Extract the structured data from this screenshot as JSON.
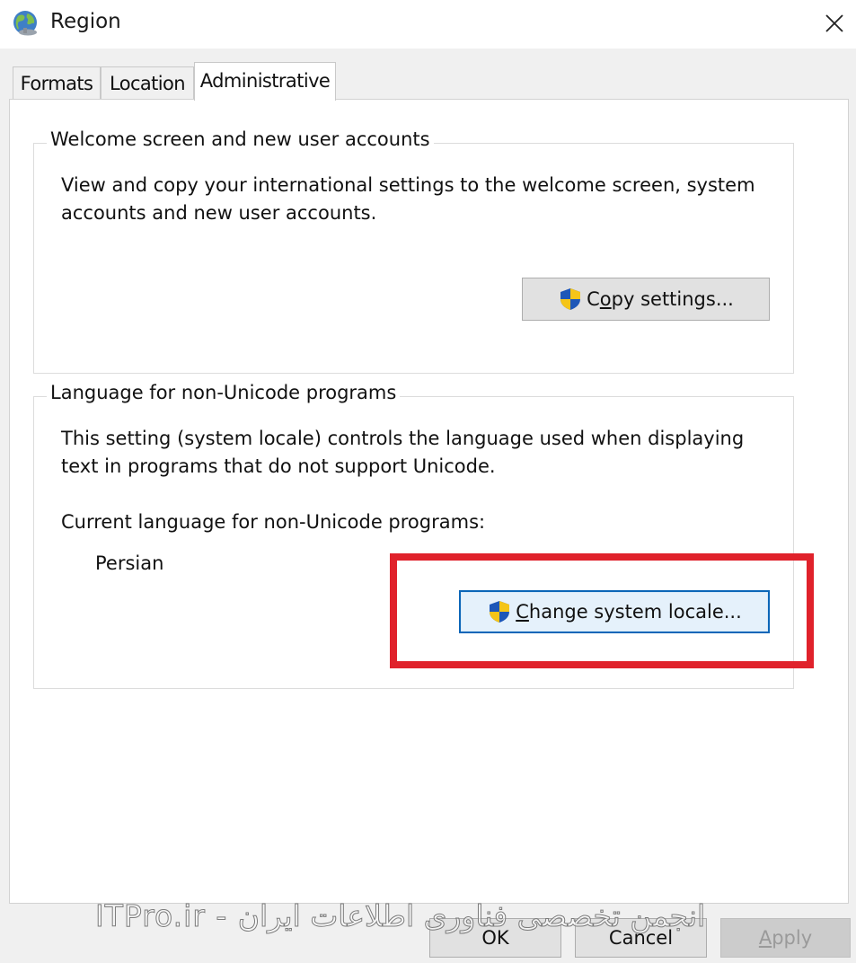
{
  "window": {
    "title": "Region",
    "close_icon": "close-icon"
  },
  "tabs": [
    {
      "label": "Formats",
      "active": false
    },
    {
      "label": "Location",
      "active": false
    },
    {
      "label": "Administrative",
      "active": true
    }
  ],
  "welcome_group": {
    "legend": "Welcome screen and new user accounts",
    "description_line1": "View and copy your international settings to the welcome screen, system",
    "description_line2": "accounts and new user accounts.",
    "copy_button": {
      "prefix": "C",
      "underlined": "o",
      "suffix": "py settings...",
      "icon": "uac-shield-icon"
    }
  },
  "locale_group": {
    "legend": "Language for non-Unicode programs",
    "description_line1": "This setting (system locale) controls the language used when displaying",
    "description_line2": "text in programs that do not support Unicode.",
    "current_label": "Current language for non-Unicode programs:",
    "current_value": "Persian",
    "change_button": {
      "underlined": "C",
      "suffix": "hange system locale...",
      "icon": "uac-shield-icon"
    }
  },
  "footer": {
    "ok_label": "OK",
    "cancel_label": "Cancel",
    "apply_prefix": "",
    "apply_underlined": "A",
    "apply_suffix": "pply"
  },
  "watermark": "ITPro.ir - انجمن تخصصی فناوری اطلاعات ایران",
  "colors": {
    "highlight": "#e0222b",
    "focus_border": "#0b66b8",
    "panel_bg": "#ffffff",
    "window_bg": "#f0f0f0"
  }
}
